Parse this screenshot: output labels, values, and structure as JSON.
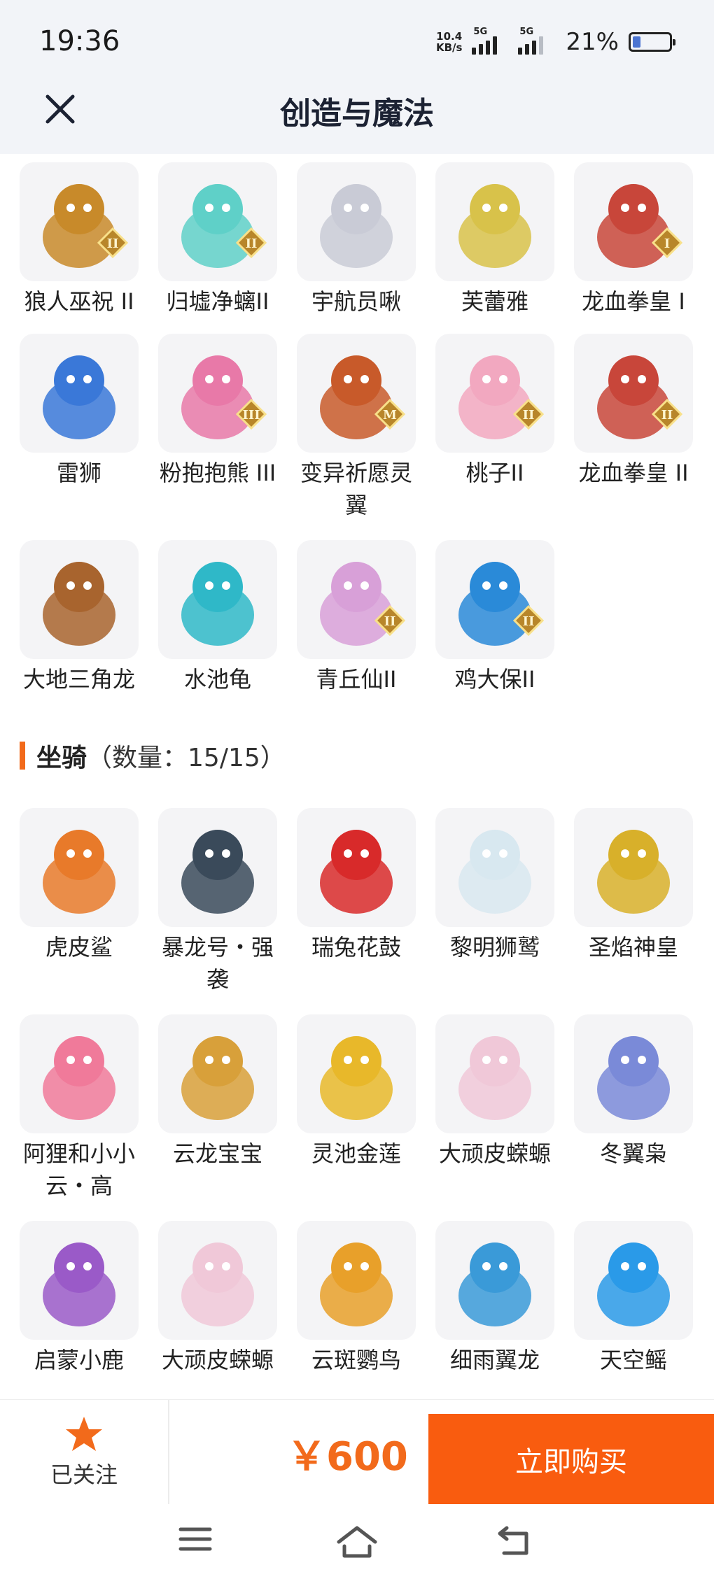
{
  "status": {
    "time": "19:36",
    "net_speed_value": "10.4",
    "net_speed_unit": "KB/s",
    "sim1": "5G",
    "sim2": "5G",
    "battery_pct": "21%",
    "battery_level": 0.21
  },
  "header": {
    "title": "创造与魔法",
    "close_icon": "close-icon"
  },
  "pets": [
    {
      "name": "狼人巫祝 II",
      "color": "#c88a2a",
      "badge": "II"
    },
    {
      "name": "归墟净螭II",
      "color": "#5fd0c8",
      "badge": "II"
    },
    {
      "name": "宇航员啾",
      "color": "#c9cbd6",
      "badge": ""
    },
    {
      "name": "芙蕾雅",
      "color": "#d8c24a",
      "badge": ""
    },
    {
      "name": "龙血拳皇 I",
      "color": "#c8463a",
      "badge": "I"
    },
    {
      "name": "雷狮",
      "color": "#3a78d8",
      "badge": ""
    },
    {
      "name": "粉抱抱熊 III",
      "color": "#e879a8",
      "badge": "III"
    },
    {
      "name": "变异祈愿灵翼",
      "color": "#c85a2a",
      "badge": "M"
    },
    {
      "name": "桃子II",
      "color": "#f2a8c0",
      "badge": "II"
    },
    {
      "name": "龙血拳皇 II",
      "color": "#c8463a",
      "badge": "II"
    },
    {
      "name": "大地三角龙",
      "color": "#a8642e",
      "badge": ""
    },
    {
      "name": "水池龟",
      "color": "#2fb8c8",
      "badge": ""
    },
    {
      "name": "青丘仙II",
      "color": "#d8a0d8",
      "badge": "II"
    },
    {
      "name": "鸡大保II",
      "color": "#2a8ad8",
      "badge": "II"
    }
  ],
  "mounts_section": {
    "title": "坐骑",
    "count": "（数量：15/15）"
  },
  "mounts": [
    {
      "name": "虎皮鲨",
      "color": "#e87a2a"
    },
    {
      "name": "暴龙号・强袭",
      "color": "#3a4a5a"
    },
    {
      "name": "瑞兔花鼓",
      "color": "#d82a2a"
    },
    {
      "name": "黎明狮鹫",
      "color": "#d8e8f0"
    },
    {
      "name": "圣焰神皇",
      "color": "#d8b02a"
    },
    {
      "name": "阿狸和小小云・高",
      "color": "#f07a9a"
    },
    {
      "name": "云龙宝宝",
      "color": "#d8a03a"
    },
    {
      "name": "灵池金莲",
      "color": "#e8b82a"
    },
    {
      "name": "大顽皮蝾螈",
      "color": "#f0c8d8"
    },
    {
      "name": "冬翼枭",
      "color": "#7a8ad8"
    },
    {
      "name": "启蒙小鹿",
      "color": "#9a5ac8"
    },
    {
      "name": "大顽皮蝾螈",
      "color": "#f0c8d8"
    },
    {
      "name": "云斑鹦鸟",
      "color": "#e8a02a"
    },
    {
      "name": "细雨翼龙",
      "color": "#3a9ad8"
    },
    {
      "name": "天空鳐",
      "color": "#2a9ae8"
    }
  ],
  "bottom": {
    "follow_label": "已关注",
    "price": "￥600",
    "buy_label": "立即购买"
  },
  "colors": {
    "accent": "#f95c0f",
    "price": "#f26a1b"
  }
}
